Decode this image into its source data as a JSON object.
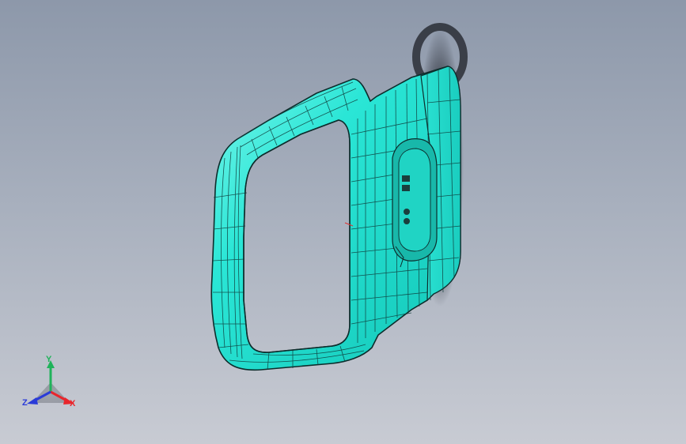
{
  "viewport": {
    "background_top": "#8d98aa",
    "background_bottom": "#c8cbd3"
  },
  "model": {
    "part": "door-frame-mesh",
    "surface_color": "#22e6d4",
    "mesh_line_color": "#0f3b3a"
  },
  "triad": {
    "x_label": "X",
    "y_label": "Y",
    "z_label": "Z",
    "x_color": "#e8262c",
    "y_color": "#1fb35a",
    "z_color": "#2a3bd8"
  }
}
